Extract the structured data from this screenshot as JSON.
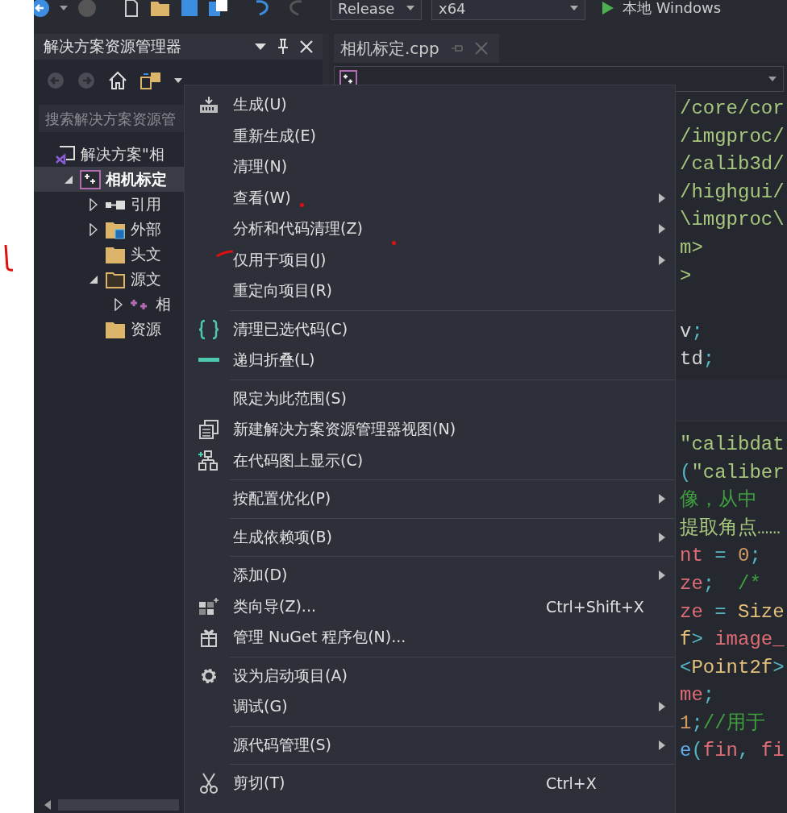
{
  "toolbar": {
    "configuration": "Release",
    "platform": "x64",
    "run_label": "本地 Windows"
  },
  "explorer": {
    "title": "解决方案资源管理器",
    "search": {
      "placeholder": "搜索解决方案资源管"
    },
    "tree": [
      {
        "label": "解决方案\"相",
        "kind": "solution",
        "selected": false,
        "expanded": true,
        "children": [
          {
            "label": "相机标定",
            "kind": "project",
            "selected": true,
            "expanded": true,
            "children": [
              {
                "label": "引用",
                "kind": "references",
                "selected": false,
                "expanded": false
              },
              {
                "label": "外部",
                "kind": "external",
                "selected": false,
                "expanded": false
              },
              {
                "label": "头文",
                "kind": "filter",
                "selected": false
              },
              {
                "label": "源文",
                "kind": "filter-open",
                "selected": false,
                "expanded": true,
                "children": [
                  {
                    "label": "相",
                    "kind": "cpp",
                    "selected": false,
                    "expanded": false
                  }
                ]
              },
              {
                "label": "资源",
                "kind": "filter",
                "selected": false
              }
            ]
          }
        ]
      }
    ]
  },
  "editor": {
    "tab": "相机标定.cpp",
    "top_lines": [
      {
        "kind": "code",
        "segments": [
          {
            "t": "/core/cor",
            "kind": "string"
          }
        ]
      },
      {
        "kind": "code",
        "segments": [
          {
            "t": "/imgproc/",
            "kind": "string"
          }
        ]
      },
      {
        "kind": "code",
        "segments": [
          {
            "t": "/calib3d/",
            "kind": "string"
          }
        ]
      },
      {
        "kind": "code",
        "segments": [
          {
            "t": "/highgui/",
            "kind": "string"
          }
        ]
      },
      {
        "kind": "code",
        "segments": [
          {
            "t": "\\imgproc\\",
            "kind": "string"
          }
        ]
      },
      {
        "kind": "code",
        "segments": [
          {
            "t": "m>",
            "kind": "string"
          }
        ]
      },
      {
        "kind": "code",
        "segments": [
          {
            "t": ">",
            "kind": "string"
          }
        ]
      },
      {
        "kind": "blank"
      },
      {
        "kind": "code",
        "segments": [
          {
            "t": "v",
            "kind": "plain"
          },
          {
            "t": ";",
            "kind": "punct"
          }
        ]
      },
      {
        "kind": "code",
        "segments": [
          {
            "t": "td",
            "kind": "plain"
          },
          {
            "t": ";",
            "kind": "punct"
          }
        ]
      }
    ],
    "bottom_lines": [
      {
        "kind": "code",
        "segments": [
          {
            "t": "\"calibdat",
            "kind": "string"
          }
        ]
      },
      {
        "kind": "code",
        "segments": [
          {
            "t": "(",
            "kind": "punct"
          },
          {
            "t": "\"caliber",
            "kind": "string"
          }
        ]
      },
      {
        "kind": "code",
        "segments": [
          {
            "t": "像，从中",
            "kind": "comment"
          }
        ]
      },
      {
        "kind": "code",
        "segments": [
          {
            "t": "提取角点……",
            "kind": "string"
          }
        ]
      },
      {
        "kind": "code",
        "segments": [
          {
            "t": "nt",
            "kind": "ident"
          },
          {
            "t": " = ",
            "kind": "punct"
          },
          {
            "t": "0",
            "kind": "number"
          },
          {
            "t": ";",
            "kind": "punct"
          }
        ]
      },
      {
        "kind": "code",
        "segments": [
          {
            "t": "ze",
            "kind": "ident"
          },
          {
            "t": ";  ",
            "kind": "punct"
          },
          {
            "t": "/*",
            "kind": "comment"
          }
        ]
      },
      {
        "kind": "code",
        "segments": [
          {
            "t": "ze",
            "kind": "ident"
          },
          {
            "t": " = ",
            "kind": "punct"
          },
          {
            "t": "Size",
            "kind": "type"
          }
        ]
      },
      {
        "kind": "code",
        "segments": [
          {
            "t": "f",
            "kind": "type"
          },
          {
            "t": ">",
            "kind": "punct"
          },
          {
            "t": " image_",
            "kind": "ident"
          }
        ]
      },
      {
        "kind": "code",
        "segments": [
          {
            "t": "<",
            "kind": "punct"
          },
          {
            "t": "Point2f",
            "kind": "type"
          },
          {
            "t": ">",
            "kind": "punct"
          }
        ]
      },
      {
        "kind": "code",
        "segments": [
          {
            "t": "me",
            "kind": "ident"
          },
          {
            "t": ";",
            "kind": "punct"
          }
        ]
      },
      {
        "kind": "code",
        "segments": [
          {
            "t": "1",
            "kind": "number"
          },
          {
            "t": ";",
            "kind": "punct"
          },
          {
            "t": "//用于",
            "kind": "comment"
          }
        ]
      },
      {
        "kind": "code",
        "segments": [
          {
            "t": "e",
            "kind": "func"
          },
          {
            "t": "(",
            "kind": "punct"
          },
          {
            "t": "fin",
            "kind": "ident"
          },
          {
            "t": ", ",
            "kind": "punct"
          },
          {
            "t": "fi",
            "kind": "ident"
          }
        ]
      }
    ]
  },
  "context_menu": {
    "items": [
      {
        "kind": "build",
        "label": "生成(U)",
        "submenu": false,
        "disabled": false
      },
      {
        "kind": "item",
        "label": "重新生成(E)",
        "submenu": false,
        "disabled": false
      },
      {
        "kind": "item",
        "label": "清理(N)",
        "submenu": false,
        "disabled": false
      },
      {
        "kind": "item",
        "label": "查看(W)",
        "submenu": true,
        "disabled": false
      },
      {
        "kind": "item",
        "label": "分析和代码清理(Z)",
        "submenu": true,
        "disabled": false
      },
      {
        "kind": "item",
        "label": "仅用于项目(J)",
        "submenu": true,
        "disabled": false
      },
      {
        "kind": "item",
        "label": "重定向项目(R)",
        "submenu": false,
        "disabled": false
      },
      {
        "kind": "separator"
      },
      {
        "kind": "braces",
        "label": "清理已选代码(C)",
        "submenu": false,
        "disabled": false
      },
      {
        "kind": "collapse",
        "label": "递归折叠(L)",
        "submenu": false,
        "disabled": false
      },
      {
        "kind": "separator"
      },
      {
        "kind": "item",
        "label": "限定为此范围(S)",
        "submenu": false,
        "disabled": false
      },
      {
        "kind": "window",
        "label": "新建解决方案资源管理器视图(N)",
        "submenu": false,
        "disabled": false
      },
      {
        "kind": "diagram",
        "label": "在代码图上显示(C)",
        "submenu": false,
        "disabled": false
      },
      {
        "kind": "separator"
      },
      {
        "kind": "item",
        "label": "按配置优化(P)",
        "submenu": true,
        "disabled": false
      },
      {
        "kind": "separator"
      },
      {
        "kind": "item",
        "label": "生成依赖项(B)",
        "submenu": true,
        "disabled": false
      },
      {
        "kind": "separator"
      },
      {
        "kind": "item",
        "label": "添加(D)",
        "submenu": true,
        "disabled": false
      },
      {
        "kind": "wizard",
        "label": "类向导(Z)...",
        "shortcut": "Ctrl+Shift+X",
        "submenu": false,
        "disabled": false
      },
      {
        "kind": "gift",
        "label": "管理 NuGet 程序包(N)...",
        "submenu": false,
        "disabled": false
      },
      {
        "kind": "separator"
      },
      {
        "kind": "gear",
        "label": "设为启动项目(A)",
        "submenu": false,
        "disabled": false
      },
      {
        "kind": "item",
        "label": "调试(G)",
        "submenu": true,
        "disabled": false
      },
      {
        "kind": "separator"
      },
      {
        "kind": "item",
        "label": "源代码管理(S)",
        "submenu": true,
        "disabled": false
      },
      {
        "kind": "separator"
      },
      {
        "kind": "scissors",
        "label": "剪切(T)",
        "shortcut": "Ctrl+X",
        "submenu": false,
        "disabled": false
      }
    ]
  }
}
